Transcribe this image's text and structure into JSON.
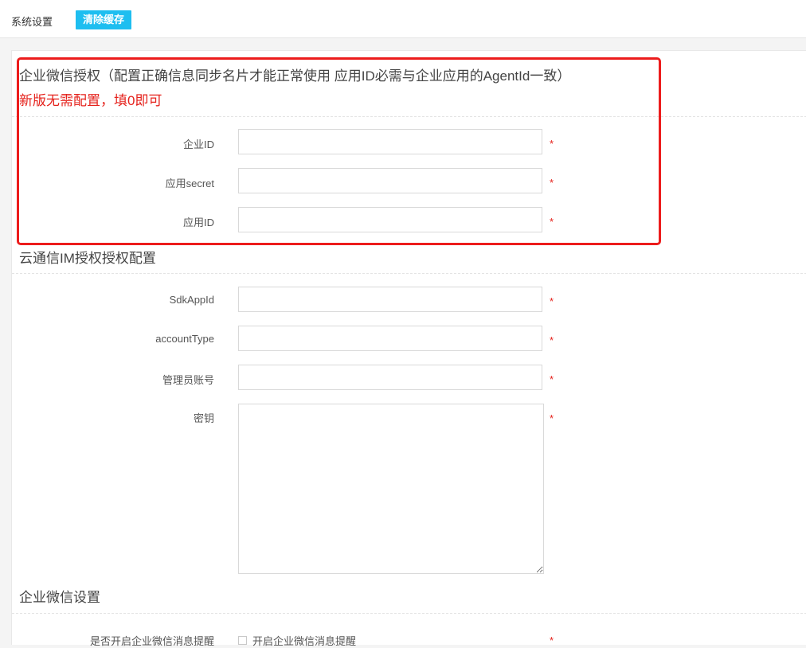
{
  "header": {
    "title": "系统设置",
    "clear_cache_label": "清除缓存"
  },
  "wechat_auth": {
    "title": "企业微信授权（配置正确信息同步名片才能正常使用 应用ID必需与企业应用的AgentId一致）",
    "note": "新版无需配置，填0即可",
    "fields": [
      {
        "label": "企业ID",
        "value": "",
        "required": "*"
      },
      {
        "label": "应用secret",
        "value": "",
        "required": "*"
      },
      {
        "label": "应用ID",
        "value": "",
        "required": "*"
      }
    ]
  },
  "im_auth": {
    "title": "云通信IM授权授权配置",
    "fields": [
      {
        "label": "SdkAppId",
        "value": "",
        "required": "*"
      },
      {
        "label": "accountType",
        "value": "",
        "required": "*"
      },
      {
        "label": "管理员账号",
        "value": "",
        "required": "*"
      }
    ],
    "secret": {
      "label": "密钥",
      "value": "",
      "required": "*"
    }
  },
  "wechat_settings": {
    "title": "企业微信设置",
    "notify": {
      "label": "是否开启企业微信消息提醒",
      "checkbox_label": "开启企业微信消息提醒",
      "checked": false,
      "required": "*"
    }
  },
  "colors": {
    "accent_button": "#1ebef0",
    "required_mark": "#e5221c",
    "highlight_border": "#ec1c1c"
  }
}
